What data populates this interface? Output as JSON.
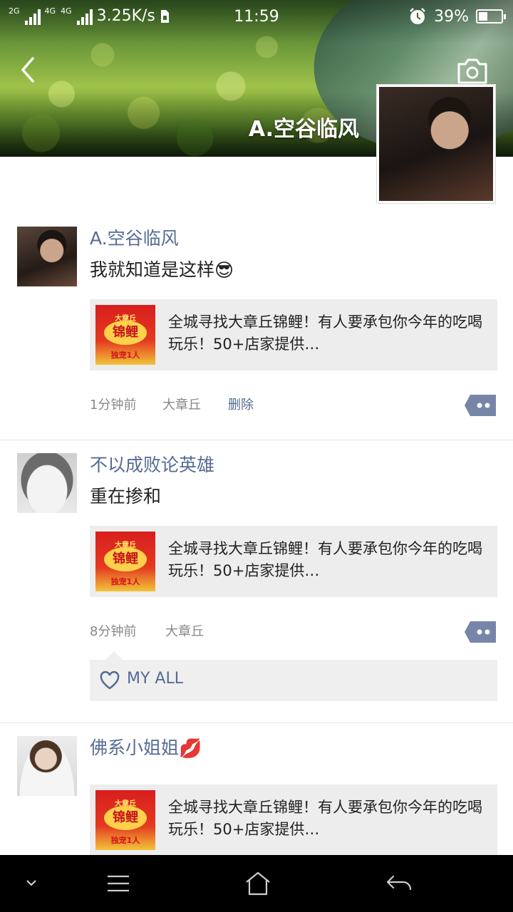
{
  "status_bar": {
    "network_1": "2G",
    "network_2": "4G",
    "network_3": "4G",
    "speed": "3.25K/s",
    "time": "11:59",
    "battery": "39%",
    "battery_level": 0.39
  },
  "header": {
    "back_icon": "back-chevron-icon",
    "camera_icon": "camera-icon",
    "profile_name": "A.空谷临风"
  },
  "posts": [
    {
      "username": "A.空谷临风",
      "text": "我就知道是这样",
      "emoji": "😎",
      "link_thumb": {
        "top": "大章丘",
        "middle": "锦鲤",
        "bottom": "独宠1人"
      },
      "link_text": "全城寻找大章丘锦鲤！有人要承包你今年的吃喝玩乐！50+店家提供…",
      "time": "1分钟前",
      "location": "大章丘",
      "delete": "删除"
    },
    {
      "username": "不以成败论英雄",
      "text": "重在掺和",
      "link_thumb": {
        "top": "大章丘",
        "middle": "锦鲤",
        "bottom": "独宠1人"
      },
      "link_text": "全城寻找大章丘锦鲤！有人要承包你今年的吃喝玩乐！50+店家提供…",
      "time": "8分钟前",
      "location": "大章丘",
      "like_name": "MY ALL"
    },
    {
      "username": "佛系小姐姐",
      "emoji": "💋",
      "link_thumb": {
        "top": "大章丘",
        "middle": "锦鲤",
        "bottom": "独宠1人"
      },
      "link_text": "全城寻找大章丘锦鲤！有人要承包你今年的吃喝玩乐！50+店家提供…"
    }
  ],
  "navbar": {
    "down_icon": "chevron-down-icon",
    "menu_icon": "menu-icon",
    "home_icon": "home-icon",
    "back_icon": "return-icon"
  }
}
